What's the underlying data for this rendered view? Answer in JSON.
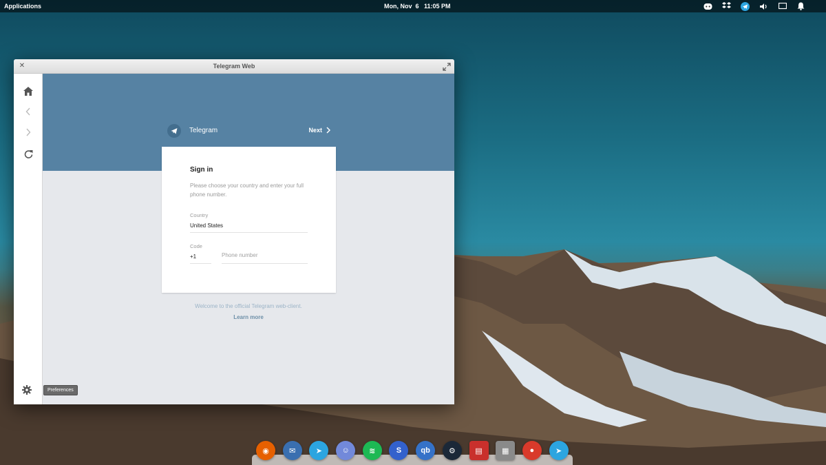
{
  "topbar": {
    "applications": "Applications",
    "clock": "Mon, Nov  6   11:05 PM",
    "tray_icons": [
      "discord-icon",
      "dropbox-icon",
      "telegram-icon",
      "volume-icon",
      "display-icon",
      "notification-bell-icon"
    ]
  },
  "window": {
    "title": "Telegram Web",
    "sidebar_items": [
      "home-icon",
      "back-icon",
      "forward-icon",
      "reload-icon",
      "settings-icon"
    ],
    "tooltip": "Preferences"
  },
  "telegram": {
    "app_name": "Telegram",
    "next_label": "Next",
    "signin": {
      "title": "Sign in",
      "description": "Please choose your country and enter your full phone number.",
      "country_label": "Country",
      "country_value": "United States",
      "code_label": "Code",
      "code_value": "+1",
      "phone_placeholder": "Phone number"
    },
    "welcome_text": "Welcome to the official Telegram web-client.",
    "learn_more": "Learn more"
  },
  "dock": {
    "apps": [
      {
        "name": "firefox",
        "color": "#e66000"
      },
      {
        "name": "thunderbird",
        "color": "#3a6fb0"
      },
      {
        "name": "telegram",
        "color": "#2ca5e0"
      },
      {
        "name": "discord",
        "color": "#7289da"
      },
      {
        "name": "spotify",
        "color": "#1db954"
      },
      {
        "name": "simplenote",
        "color": "#3361cc"
      },
      {
        "name": "qbittorrent",
        "color": "#3572c8"
      },
      {
        "name": "steam",
        "color": "#1b2838"
      },
      {
        "name": "red-app",
        "color": "#c9302c"
      },
      {
        "name": "archive-manager",
        "color": "#8a8a8a"
      },
      {
        "name": "tomato-timer",
        "color": "#d93a2b"
      },
      {
        "name": "telegram-desktop",
        "color": "#2ca5e0"
      }
    ]
  }
}
